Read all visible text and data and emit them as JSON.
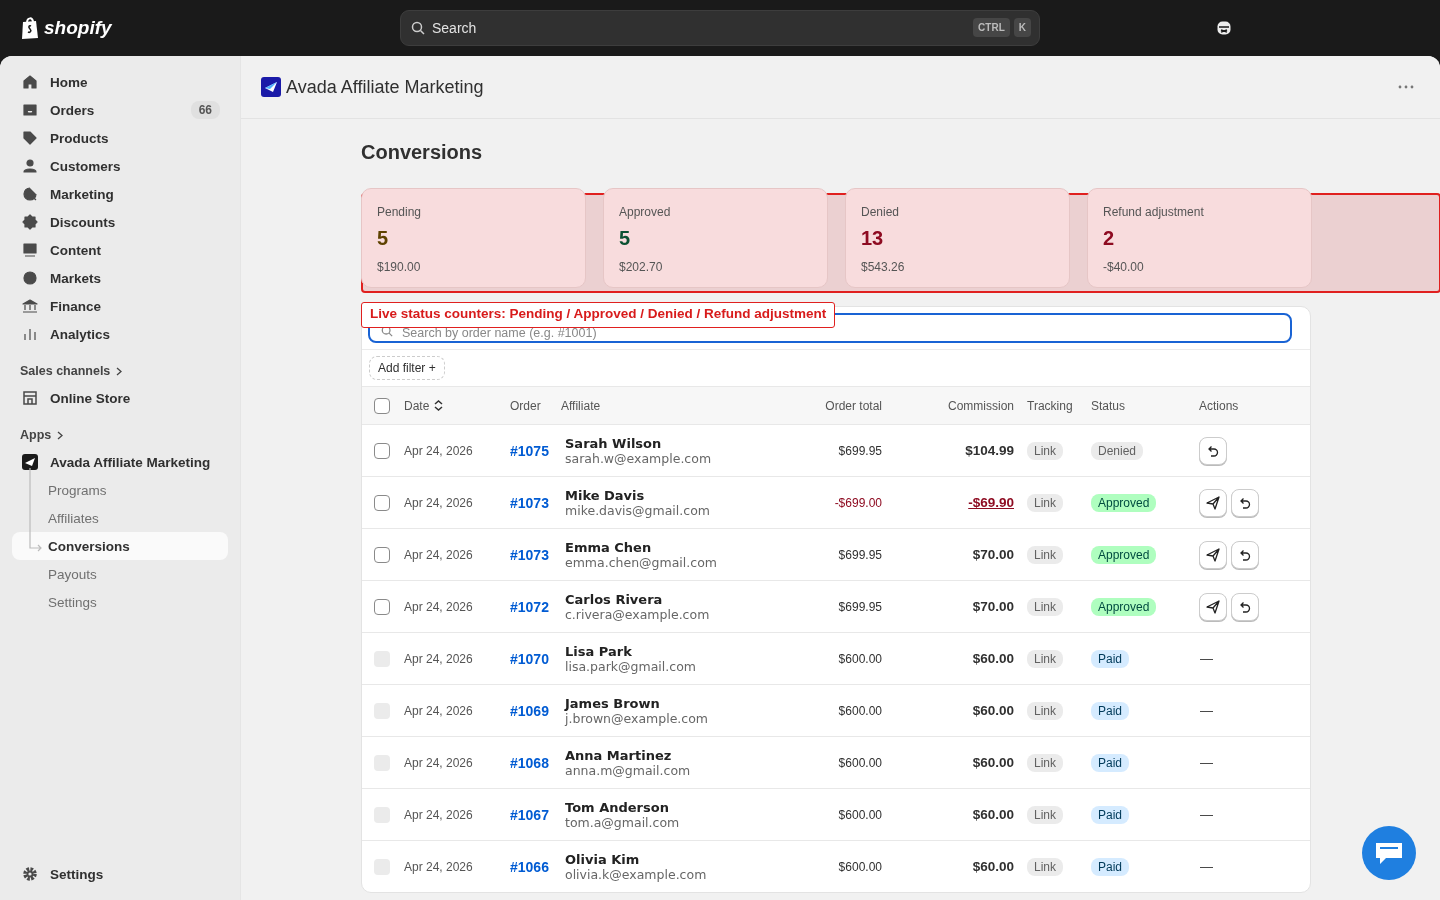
{
  "topbar": {
    "logo": "shopify",
    "search": {
      "placeholder": "Search",
      "keys": [
        "CTRL",
        "K"
      ]
    }
  },
  "sidebar": {
    "items": [
      {
        "label": "Home"
      },
      {
        "label": "Orders",
        "badge": "66"
      },
      {
        "label": "Products"
      },
      {
        "label": "Customers"
      },
      {
        "label": "Marketing"
      },
      {
        "label": "Discounts"
      },
      {
        "label": "Content"
      },
      {
        "label": "Markets"
      },
      {
        "label": "Finance"
      },
      {
        "label": "Analytics"
      }
    ],
    "sections": [
      {
        "heading": "Sales channels",
        "items": [
          {
            "label": "Online Store"
          }
        ]
      },
      {
        "heading": "Apps",
        "items": [
          {
            "label": "Avada Affiliate Marketing",
            "children": [
              {
                "label": "Programs",
                "selected": false
              },
              {
                "label": "Affiliates",
                "selected": false
              },
              {
                "label": "Conversions",
                "selected": true
              },
              {
                "label": "Payouts",
                "selected": false
              },
              {
                "label": "Settings",
                "selected": false
              }
            ]
          }
        ]
      }
    ],
    "footer": {
      "label": "Settings"
    }
  },
  "page_header": {
    "title": "Avada Affiliate Marketing"
  },
  "page": {
    "title": "Conversions"
  },
  "stats": [
    {
      "label": "Pending",
      "count": "5",
      "amount": "$190.00",
      "color": "#5e4200"
    },
    {
      "label": "Approved",
      "count": "5",
      "amount": "$202.70",
      "color": "#0c5132"
    },
    {
      "label": "Denied",
      "count": "13",
      "amount": "$543.26",
      "color": "#8e0b21"
    },
    {
      "label": "Refund adjustment",
      "count": "2",
      "amount": "-$40.00",
      "color": "#8e0b21"
    }
  ],
  "annotation": {
    "label": "Live status counters: Pending / Approved / Denied / Refund adjustment"
  },
  "table": {
    "search": {
      "placeholder": "Search by order name (e.g. #1001)"
    },
    "add_filter": "Add filter +",
    "select_all": {
      "checked": false
    },
    "columns": [
      "Date",
      "Order",
      "Affiliate",
      "Order total",
      "Commission",
      "Tracking",
      "Status",
      "Actions"
    ],
    "rows": [
      {
        "disabled": false,
        "date": "Apr 24, 2026",
        "order": "#1075",
        "name": "Sarah Wilson",
        "email": "sarah.w@example.com",
        "total": "$699.95",
        "commission": "$104.99",
        "negative": false,
        "tracking": "Link",
        "status": {
          "label": "Denied",
          "kind": "denied"
        },
        "actions": [
          {
            "kind": "undo"
          }
        ]
      },
      {
        "disabled": false,
        "date": "Apr 24, 2026",
        "order": "#1073",
        "name": "Mike Davis",
        "email": "mike.davis@gmail.com",
        "total": "-$699.00",
        "commission": "-$69.90",
        "negative": true,
        "tracking": "Link",
        "status": {
          "label": "Approved",
          "kind": "approved"
        },
        "actions": [
          {
            "kind": "send"
          },
          {
            "kind": "undo"
          }
        ]
      },
      {
        "disabled": false,
        "date": "Apr 24, 2026",
        "order": "#1073",
        "name": "Emma Chen",
        "email": "emma.chen@gmail.com",
        "total": "$699.95",
        "commission": "$70.00",
        "negative": false,
        "tracking": "Link",
        "status": {
          "label": "Approved",
          "kind": "approved"
        },
        "actions": [
          {
            "kind": "send"
          },
          {
            "kind": "undo"
          }
        ]
      },
      {
        "disabled": false,
        "date": "Apr 24, 2026",
        "order": "#1072",
        "name": "Carlos Rivera",
        "email": "c.rivera@example.com",
        "total": "$699.95",
        "commission": "$70.00",
        "negative": false,
        "tracking": "Link",
        "status": {
          "label": "Approved",
          "kind": "approved"
        },
        "actions": [
          {
            "kind": "send"
          },
          {
            "kind": "undo"
          }
        ]
      },
      {
        "disabled": true,
        "date": "Apr 24, 2026",
        "order": "#1070",
        "name": "Lisa Park",
        "email": "lisa.park@gmail.com",
        "total": "$600.00",
        "commission": "$60.00",
        "negative": false,
        "tracking": "Link",
        "status": {
          "label": "Paid",
          "kind": "paid"
        },
        "action_text": "—"
      },
      {
        "disabled": true,
        "date": "Apr 24, 2026",
        "order": "#1069",
        "name": "James Brown",
        "email": "j.brown@example.com",
        "total": "$600.00",
        "commission": "$60.00",
        "negative": false,
        "tracking": "Link",
        "status": {
          "label": "Paid",
          "kind": "paid"
        },
        "action_text": "—"
      },
      {
        "disabled": true,
        "date": "Apr 24, 2026",
        "order": "#1068",
        "name": "Anna Martinez",
        "email": "anna.m@gmail.com",
        "total": "$600.00",
        "commission": "$60.00",
        "negative": false,
        "tracking": "Link",
        "status": {
          "label": "Paid",
          "kind": "paid"
        },
        "action_text": "—"
      },
      {
        "disabled": true,
        "date": "Apr 24, 2026",
        "order": "#1067",
        "name": "Tom Anderson",
        "email": "tom.a@gmail.com",
        "total": "$600.00",
        "commission": "$60.00",
        "negative": false,
        "tracking": "Link",
        "status": {
          "label": "Paid",
          "kind": "paid"
        },
        "action_text": "—"
      },
      {
        "disabled": true,
        "date": "Apr 24, 2026",
        "order": "#1066",
        "name": "Olivia Kim",
        "email": "olivia.k@example.com",
        "total": "$600.00",
        "commission": "$60.00",
        "negative": false,
        "tracking": "Link",
        "status": {
          "label": "Paid",
          "kind": "paid"
        },
        "action_text": "—"
      }
    ]
  }
}
